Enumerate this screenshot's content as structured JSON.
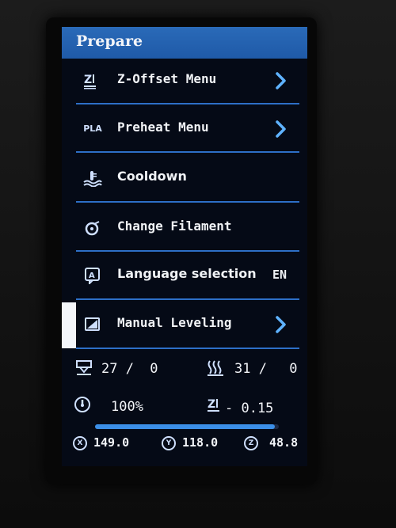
{
  "title": "Prepare",
  "menu": [
    {
      "label": "Z-Offset Menu",
      "icon": "zoffset-icon",
      "has_arrow": true
    },
    {
      "label": "Preheat Menu",
      "icon": "pla-icon",
      "icon_text": "PLA",
      "has_arrow": true
    },
    {
      "label": "Cooldown",
      "icon": "cooldown-icon",
      "has_arrow": false
    },
    {
      "label": "Change Filament",
      "icon": "filament-icon",
      "has_arrow": false
    },
    {
      "label": "Language selection",
      "icon": "language-icon",
      "icon_text": "A",
      "value": "EN",
      "has_arrow": false
    },
    {
      "label": "Manual Leveling",
      "icon": "leveling-icon",
      "has_arrow": true,
      "selected": true
    }
  ],
  "status": {
    "hotend_temp": "27",
    "hotend_target": "0",
    "bed_temp": "31",
    "bed_target": "0",
    "feedrate_percent": "100%",
    "zoffset_label": "Z",
    "zoffset_value": "- 0.15",
    "progress_fraction": 0.98,
    "x_pos": "149.0",
    "y_pos": "118.0",
    "z_pos": "48.8",
    "x_label": "X",
    "y_label": "Y",
    "z_label": "Z",
    "slash": "/"
  },
  "colors": {
    "accent": "#2d6fc7",
    "title_bg": "#1f5aa8",
    "screen_bg": "#050a16",
    "text": "#f0f2f5"
  }
}
